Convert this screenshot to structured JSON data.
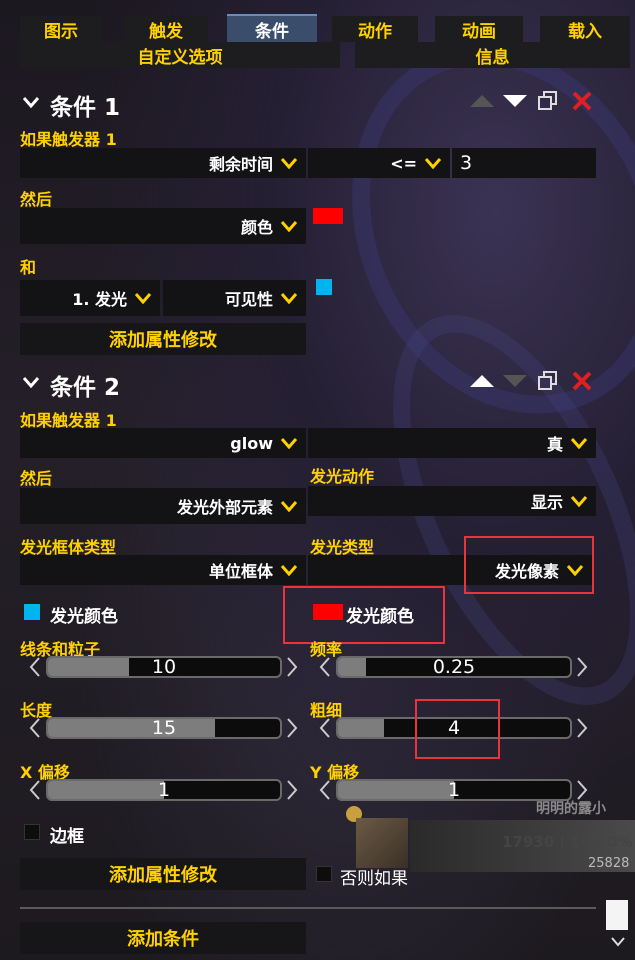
{
  "tabs": [
    "图示",
    "触发",
    "条件",
    "动作",
    "动画",
    "载入"
  ],
  "tabs2": [
    "自定义选项",
    "信息"
  ],
  "cond1": {
    "title": "条件 1",
    "trigger_label": "如果触发器 1",
    "dd_remaining": "剩余时间",
    "dd_op": "<=",
    "value": "3",
    "then_label": "然后",
    "dd_color": "颜色",
    "and_label": "和",
    "dd_glow1": "1. 发光",
    "dd_visibility": "可见性",
    "add_prop": "添加属性修改"
  },
  "cond2": {
    "title": "条件 2",
    "trigger_label": "如果触发器 1",
    "dd_glow": "glow",
    "dd_true": "真",
    "then_label": "然后",
    "glow_action_label": "发光动作",
    "dd_external": "发光外部元素",
    "dd_show": "显示",
    "frame_type_label": "发光框体类型",
    "glow_type_label": "发光类型",
    "dd_unit_frame": "单位框体",
    "dd_pixel": "发光像素",
    "glow_color1": "发光颜色",
    "glow_color2": "发光颜色",
    "lines_label": "线条和粒子",
    "lines_value": "10",
    "lines_fill": 0.35,
    "freq_label": "频率",
    "freq_value": "0.25",
    "freq_fill": 0.12,
    "length_label": "长度",
    "length_value": "15",
    "length_fill": 0.72,
    "thick_label": "粗细",
    "thick_value": "4",
    "thick_fill": 0.2,
    "xoff_label": "X 偏移",
    "xoff_value": "1",
    "xoff_fill": 0.5,
    "yoff_label": "Y 偏移",
    "yoff_value": "1",
    "yoff_fill": 0.5,
    "border_label": "边框",
    "add_prop": "添加属性修改",
    "else_if": "否则如果"
  },
  "add_condition": "添加条件",
  "bg": {
    "player_name": "明明的露小",
    "hp": "17930 | 100.0%",
    "hp2": "25828"
  },
  "colors": {
    "accent": "#ffd100",
    "red": "#ff0000",
    "cyan": "#00b4f0",
    "active_tab": "#3a4d6b"
  }
}
